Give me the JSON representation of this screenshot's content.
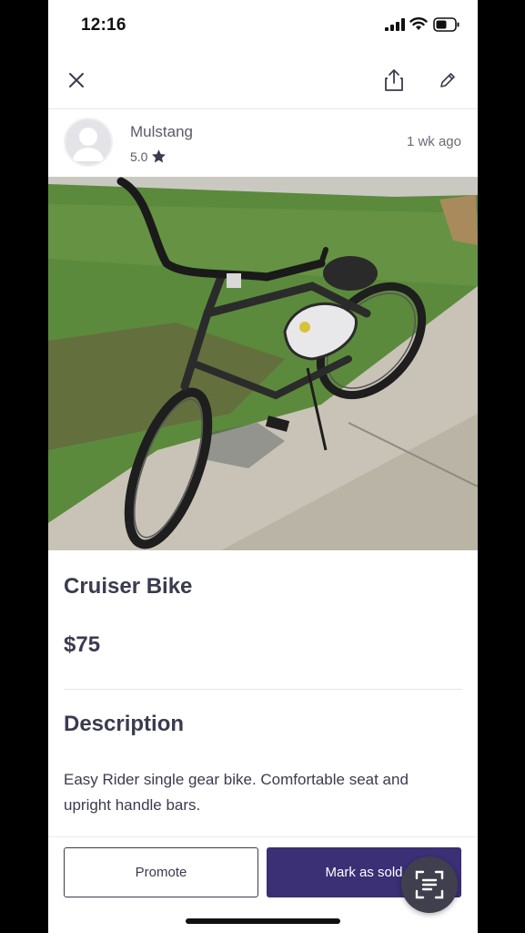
{
  "status_bar": {
    "time": "12:16"
  },
  "nav": {
    "close_icon": "close-icon",
    "share_icon": "share-icon",
    "edit_icon": "pencil-icon"
  },
  "seller": {
    "name": "Mulstang",
    "rating": "5.0",
    "posted": "1 wk  ago"
  },
  "listing": {
    "title": "Cruiser Bike",
    "price": "$75",
    "description_heading": "Description",
    "description": "Easy Rider single gear bike. Comfortable seat and upright handle bars."
  },
  "actions": {
    "promote_label": "Promote",
    "sold_label": "Mark as sold"
  },
  "colors": {
    "primary": "#3b2f75",
    "text": "#3b3b4f",
    "fab": "#3f3f4e"
  }
}
